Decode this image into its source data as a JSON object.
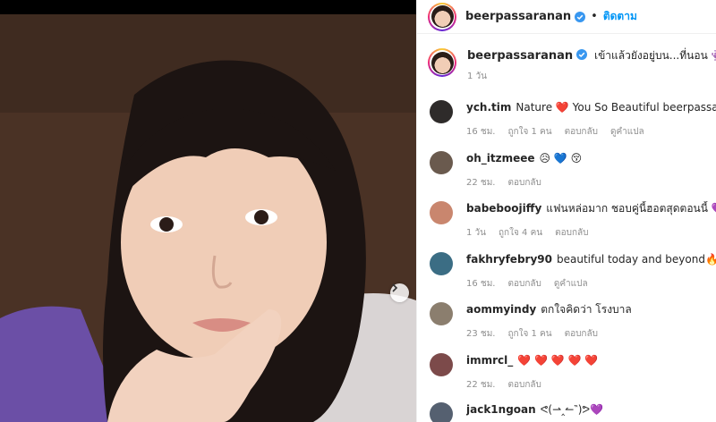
{
  "post": {
    "carousel_next_icon": "chevron-right-icon"
  },
  "header": {
    "username": "beerpassaranan",
    "separator": "•",
    "follow_label": "ติดตาม"
  },
  "caption": {
    "username": "beerpassaranan",
    "text": "เข้าแล้วยังอยู่บน...ที่นอน 👾",
    "time": "1 วัน"
  },
  "comments": [
    {
      "username": "ych.tim",
      "text": "Nature ❤️ You So Beautiful beerpassaranan",
      "time": "16 ชม.",
      "likes": "ถูกใจ 1 คน",
      "reply": "ตอบกลับ",
      "translate": "ดูคำแปล",
      "avatar_color": "#2e2b2a"
    },
    {
      "username": "oh_itzmeee",
      "text": "😥 💙 😚",
      "time": "22 ชม.",
      "likes": "",
      "reply": "ตอบกลับ",
      "translate": "",
      "avatar_color": "#6a5a4e"
    },
    {
      "username": "babeboojiffy",
      "text": "แฟนหล่อมาก ชอบคู่นี้ฮอตสุดตอนนี้ 💜",
      "time": "1 วัน",
      "likes": "ถูกใจ 4 คน",
      "reply": "ตอบกลับ",
      "translate": "",
      "avatar_color": "#c9866e"
    },
    {
      "username": "fakhryfebry90",
      "text": "beautiful today and beyond🔥",
      "time": "16 ชม.",
      "likes": "",
      "reply": "ตอบกลับ",
      "translate": "ดูคำแปล",
      "avatar_color": "#3b6d84"
    },
    {
      "username": "aommyindy",
      "text": "ตกใจคิดว่า โรงบาล",
      "time": "23 ชม.",
      "likes": "ถูกใจ 1 คน",
      "reply": "ตอบกลับ",
      "translate": "",
      "avatar_color": "#8b7e6e"
    },
    {
      "username": "immrcl_",
      "text": "❤️ ❤️ ❤️ ❤️ ❤️",
      "time": "22 ชม.",
      "likes": "",
      "reply": "ตอบกลับ",
      "translate": "",
      "avatar_color": "#7c4a4a"
    },
    {
      "username": "jack1ngoan",
      "text": "ᕙ(⇀‸↼‶)ᕗ💜",
      "time": "",
      "likes": "",
      "reply": "",
      "translate": "",
      "avatar_color": "#556070"
    }
  ],
  "colors": {
    "follow": "#0095f6",
    "verified": "#3897f0",
    "meta": "#8e8e8e"
  }
}
